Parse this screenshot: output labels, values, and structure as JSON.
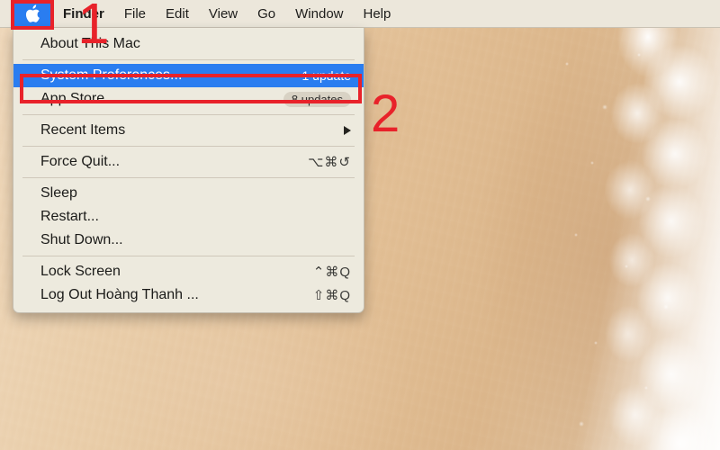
{
  "menubar": {
    "apple_icon": "apple-logo-icon",
    "items": [
      {
        "label": "Finder",
        "bold": true
      },
      {
        "label": "File",
        "bold": false
      },
      {
        "label": "Edit",
        "bold": false
      },
      {
        "label": "View",
        "bold": false
      },
      {
        "label": "Go",
        "bold": false
      },
      {
        "label": "Window",
        "bold": false
      },
      {
        "label": "Help",
        "bold": false
      }
    ]
  },
  "apple_menu": {
    "items": [
      {
        "label": "About This Mac",
        "shortcut": "",
        "badge": "",
        "badge_style": "none",
        "selected": false,
        "arrow": false
      },
      {
        "label": "System Preferences...",
        "shortcut": "",
        "badge": "1 update",
        "badge_style": "plain",
        "selected": true,
        "arrow": false
      },
      {
        "label": "App Store...",
        "shortcut": "",
        "badge": "8 updates",
        "badge_style": "pill",
        "selected": false,
        "arrow": false
      },
      {
        "label": "Recent Items",
        "shortcut": "",
        "badge": "",
        "badge_style": "none",
        "selected": false,
        "arrow": true
      },
      {
        "label": "Force Quit...",
        "shortcut": "⌥⌘↺",
        "badge": "",
        "badge_style": "none",
        "selected": false,
        "arrow": false
      },
      {
        "label": "Sleep",
        "shortcut": "",
        "badge": "",
        "badge_style": "none",
        "selected": false,
        "arrow": false
      },
      {
        "label": "Restart...",
        "shortcut": "",
        "badge": "",
        "badge_style": "none",
        "selected": false,
        "arrow": false
      },
      {
        "label": "Shut Down...",
        "shortcut": "",
        "badge": "",
        "badge_style": "none",
        "selected": false,
        "arrow": false
      },
      {
        "label": "Lock Screen",
        "shortcut": "⌃⌘Q",
        "badge": "",
        "badge_style": "none",
        "selected": false,
        "arrow": false
      },
      {
        "label": "Log Out Hoàng Thanh ...",
        "shortcut": "⇧⌘Q",
        "badge": "",
        "badge_style": "none",
        "selected": false,
        "arrow": false
      }
    ]
  },
  "annotations": {
    "step_one": "1",
    "step_two": "2",
    "color": "#e8222a"
  },
  "colors": {
    "menubar_bg": "#ece7db",
    "menu_bg": "#edeade",
    "highlight_blue": "#2a7df0",
    "annotation_red": "#e8222a",
    "badge_pill_bg": "#d8d2c4"
  },
  "desktop": {
    "wallpaper_description": "beach-sand-and-surf-wallpaper"
  }
}
